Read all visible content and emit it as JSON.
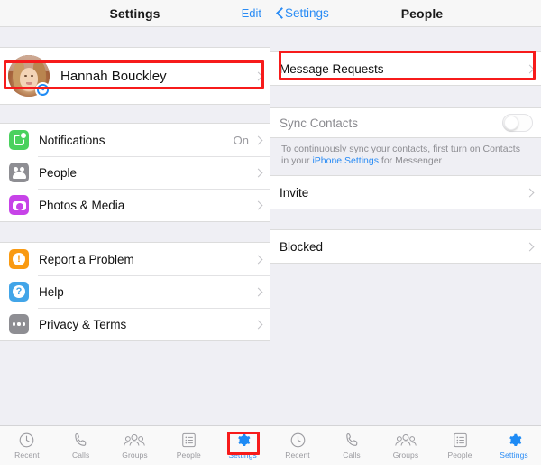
{
  "left_screen": {
    "navbar": {
      "title": "Settings",
      "edit_label": "Edit"
    },
    "profile": {
      "name": "Hannah Bouckley",
      "badge_icon": "messenger-badge-icon"
    },
    "group_one": [
      {
        "label": "Notifications",
        "value": "On",
        "icon": "notifications-icon",
        "icon_color": "#4ad15e"
      },
      {
        "label": "People",
        "value": "",
        "icon": "people-icon",
        "icon_color": "#8e8e93",
        "highlighted": true
      },
      {
        "label": "Photos & Media",
        "value": "",
        "icon": "photos-media-icon",
        "icon_color": "#c743e8"
      }
    ],
    "group_two": [
      {
        "label": "Report a Problem",
        "value": "",
        "icon": "report-problem-icon",
        "icon_color": "#f99a12"
      },
      {
        "label": "Help",
        "value": "",
        "icon": "help-icon",
        "icon_color": "#42a5e8"
      },
      {
        "label": "Privacy & Terms",
        "value": "",
        "icon": "privacy-terms-icon",
        "icon_color": "#8e8e93"
      }
    ],
    "tabs": [
      {
        "label": "Recent",
        "icon": "clock-icon",
        "active": false
      },
      {
        "label": "Calls",
        "icon": "phone-icon",
        "active": false
      },
      {
        "label": "Groups",
        "icon": "groups-icon",
        "active": false
      },
      {
        "label": "People",
        "icon": "list-icon",
        "active": false
      },
      {
        "label": "Settings",
        "icon": "gear-icon",
        "active": true,
        "highlighted": true
      }
    ]
  },
  "right_screen": {
    "navbar": {
      "back_label": "Settings",
      "title": "People"
    },
    "rows_top": [
      {
        "label": "Message Requests",
        "highlighted": true
      }
    ],
    "sync": {
      "label": "Sync Contacts",
      "toggle_state": "off",
      "note_part1": "To continuously sync your contacts, first turn on Contacts in your ",
      "note_link": "iPhone Settings",
      "note_part2": " for Messenger"
    },
    "rows_invite": [
      {
        "label": "Invite"
      }
    ],
    "rows_blocked": [
      {
        "label": "Blocked"
      }
    ],
    "tabs": [
      {
        "label": "Recent",
        "icon": "clock-icon",
        "active": false
      },
      {
        "label": "Calls",
        "icon": "phone-icon",
        "active": false
      },
      {
        "label": "Groups",
        "icon": "groups-icon",
        "active": false
      },
      {
        "label": "People",
        "icon": "list-icon",
        "active": false
      },
      {
        "label": "Settings",
        "icon": "gear-icon",
        "active": true
      }
    ]
  },
  "colors": {
    "accent_blue": "#2a8cf5",
    "highlight_red": "#f71b1b",
    "background_gray": "#efeff4"
  }
}
